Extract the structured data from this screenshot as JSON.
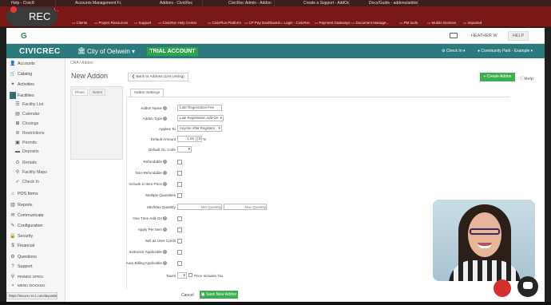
{
  "recording": {
    "label": "REC",
    "color": "#e53935"
  },
  "browser": {
    "tabs": [
      "Help - CivicR",
      "Accounts Management Fac...",
      "Addons - CivicRec",
      "CivicRec Admin - Addon",
      "Create a Support - AddOdd",
      "Docs/Guide - addons/addon"
    ],
    "url": "civicrec.com/..."
  },
  "bookmarks": [
    "Clients",
    "Project Resources",
    "Support",
    "CivicRec Help Center",
    "CivicPlus Platform",
    "CP Pay Dashboard",
    "Login - CivicRec",
    "Payment Gateways",
    "Document Manage...",
    "PM tools",
    "Mobile Devices",
    "Imported"
  ],
  "header": {
    "user": "HEATHER W",
    "help": "HELP",
    "brand": "CIVICREC",
    "city": "City of Oelwein",
    "trial": "TRIAL ACCOUNT",
    "check_in": "Check In",
    "location": "Community Park - Example",
    "accent": "#2a7a7e",
    "trial_color": "#2fa54a"
  },
  "sidebar": {
    "items": [
      {
        "label": "Accounts",
        "icon": "person-icon"
      },
      {
        "label": "Catalog",
        "icon": "cart-icon"
      },
      {
        "label": "Activities",
        "icon": "activity-icon"
      },
      {
        "label": "Facilities",
        "icon": "building-icon"
      },
      {
        "label": "Facility List",
        "icon": "list-icon"
      },
      {
        "label": "Calendar",
        "icon": "calendar-icon"
      },
      {
        "label": "Closings",
        "icon": "closing-icon"
      },
      {
        "label": "Restrictions",
        "icon": "restriction-icon"
      },
      {
        "label": "Permits",
        "icon": "permit-icon"
      },
      {
        "label": "Deposits",
        "icon": "deposit-icon"
      },
      {
        "label": "Rentals",
        "icon": "rental-icon"
      },
      {
        "label": "Facility Maps",
        "icon": "map-pin-icon"
      },
      {
        "label": "Check In",
        "icon": "check-icon"
      },
      {
        "label": "POS Items",
        "icon": "tag-icon"
      },
      {
        "label": "Reports",
        "icon": "report-icon"
      },
      {
        "label": "Communicate",
        "icon": "message-icon"
      },
      {
        "label": "Configuration",
        "icon": "wrench-icon"
      },
      {
        "label": "Security",
        "icon": "lock-icon"
      },
      {
        "label": "Financial",
        "icon": "money-icon"
      },
      {
        "label": "Questions",
        "icon": "gear-icon"
      },
      {
        "label": "Support",
        "icon": "support-icon"
      },
      {
        "label": "PINNED OPEN",
        "icon": "pin-icon"
      },
      {
        "label": "MENU DOCKED",
        "icon": "dock-icon"
      }
    ]
  },
  "main": {
    "breadcrumb": "CRA / Addon",
    "title": "New Addon",
    "back_label": "Back to Addons (List Listing)",
    "create_label": "+ Create Addon",
    "help_label": "Help",
    "left_tabs": [
      "Photo",
      "Notes"
    ],
    "form_tab": "Addon Settings",
    "fields": {
      "name": {
        "label": "Addon Name",
        "value": "Late Registration Fee"
      },
      "type": {
        "label": "Addon Type",
        "value": "Late Registration Add-On"
      },
      "applies_to": {
        "label": "Applies To",
        "value": "Anyone After Registers"
      },
      "default_amount": {
        "label": "Default Amount",
        "value": "1.00",
        "unit": "%"
      },
      "gl_code": {
        "label": "Default GL Code",
        "value": ""
      },
      "refundable": {
        "label": "Refundable"
      },
      "non_refundable": {
        "label": "Non-Refundable"
      },
      "include_in_price": {
        "label": "Include in Item Price"
      },
      "multiple_quantities": {
        "label": "Multiple Quantities"
      },
      "min_max_quantity": {
        "label": "Min/Max Quantity",
        "min_placeholder": "Min Quantity",
        "max_placeholder": "Max Quantity"
      },
      "one_time": {
        "label": "One Time Add-On"
      },
      "apply_per_item": {
        "label": "Apply Per Item"
      },
      "sell_as_user_credit": {
        "label": "Sell as User Credit"
      },
      "instructor_applicable": {
        "label": "Instructor Applicable"
      },
      "auto_billing": {
        "label": "Auto Billing Applicable"
      },
      "taxes": {
        "label": "Taxes",
        "value": "",
        "price_includes_tax": "Price Includes Tax"
      }
    },
    "cancel_label": "Cancel",
    "save_label": "Save New Addon"
  },
  "status_url": "https://secure.rec1.com/deposits"
}
